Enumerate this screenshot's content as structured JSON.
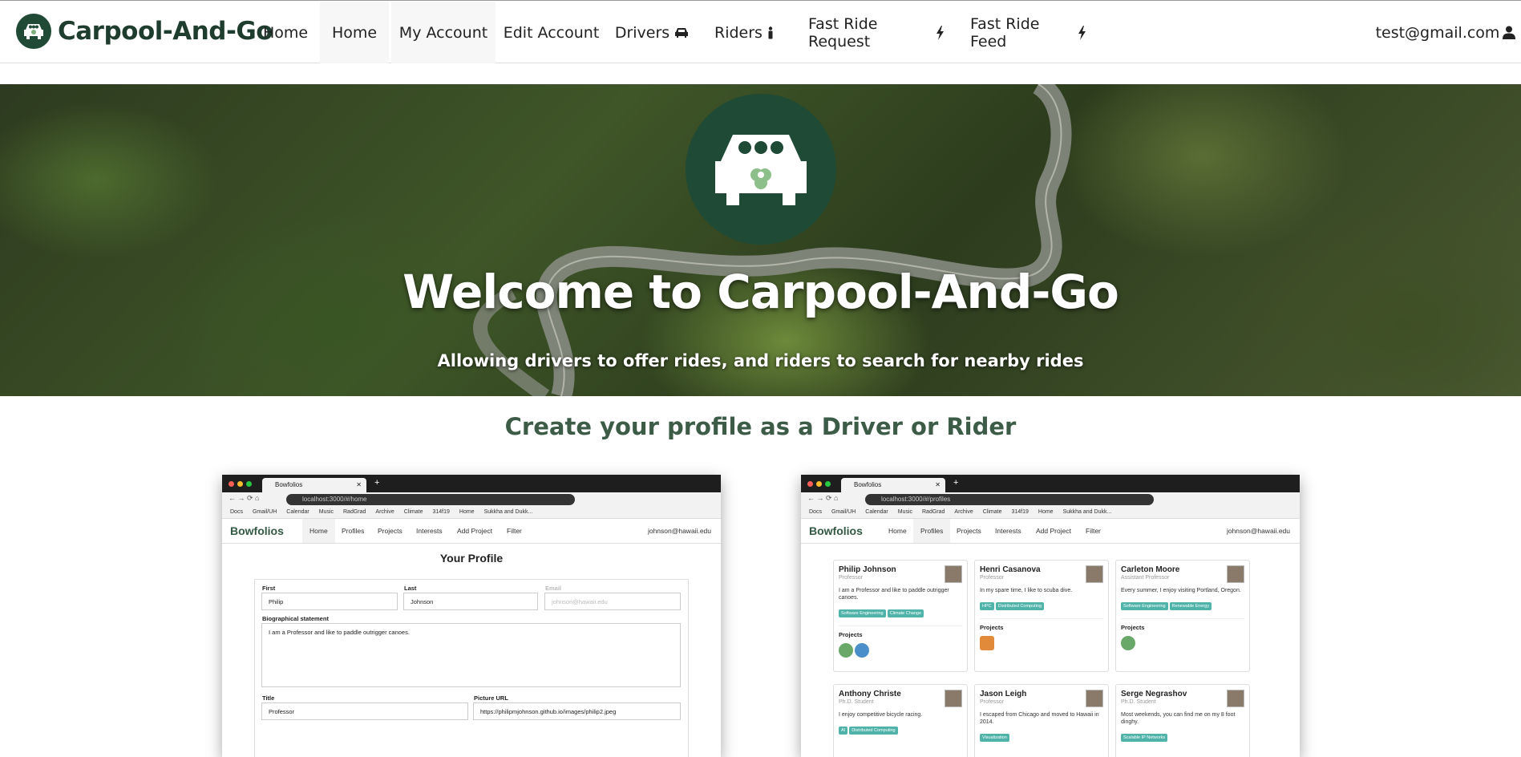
{
  "nav": {
    "brand": "Carpool-And-Go",
    "items": [
      "Home",
      "Home",
      "My Account",
      "Edit Account",
      "Drivers",
      "Riders",
      "Fast Ride Request",
      "Fast Ride Feed"
    ],
    "user": "test@gmail.com"
  },
  "hero": {
    "title": "Welcome to Carpool-And-Go",
    "subtitle": "Allowing drivers to offer rides, and riders to search for nearby rides"
  },
  "section": {
    "title": "Create your profile as a Driver or Rider"
  },
  "shot1": {
    "tab": "Bowfolios",
    "url": "localhost:3000/#/home",
    "bookmarks": [
      "Docs",
      "Gmail/UH",
      "Calendar",
      "Music",
      "RadGrad",
      "Archive",
      "Climate",
      "314f19",
      "Home",
      "Sukkha and Dukk..."
    ],
    "brand": "Bowfolios",
    "links": [
      "Home",
      "Profiles",
      "Projects",
      "Interests",
      "Add Project",
      "Filter"
    ],
    "user": "johnson@hawaii.edu",
    "form_title": "Your Profile",
    "first_label": "First",
    "first_value": "Philip",
    "last_label": "Last",
    "last_value": "Johnson",
    "email_label": "Email",
    "email_value": "johnson@hawaii.edu",
    "bio_label": "Biographical statement",
    "bio_value": "I am a Professor and like to paddle outrigger canoes.",
    "title_label": "Title",
    "title_value": "Professor",
    "picture_label": "Picture URL",
    "picture_value": "https://philipmjohnson.github.io/images/philip2.jpeg"
  },
  "shot2": {
    "tab": "Bowfolios",
    "url": "localhost:3000/#/profiles",
    "bookmarks": [
      "Docs",
      "Gmail/UH",
      "Calendar",
      "Music",
      "RadGrad",
      "Archive",
      "Climate",
      "314f19",
      "Home",
      "Sukkha and Dukk..."
    ],
    "brand": "Bowfolios",
    "links": [
      "Home",
      "Profiles",
      "Projects",
      "Interests",
      "Add Project",
      "Filter"
    ],
    "user": "johnson@hawaii.edu",
    "projects_label": "Projects",
    "cards": [
      {
        "name": "Philip Johnson",
        "role": "Professor",
        "bio": "I am a Professor and like to paddle outrigger canoes.",
        "tags": [
          "Software Engineering",
          "Climate Change"
        ]
      },
      {
        "name": "Henri Casanova",
        "role": "Professor",
        "bio": "In my spare time, I like to scuba dive.",
        "tags": [
          "HPC",
          "Distributed Computing"
        ]
      },
      {
        "name": "Carleton Moore",
        "role": "Assistant Professor",
        "bio": "Every summer, I enjoy visiting Portland, Oregon.",
        "tags": [
          "Software Engineering",
          "Renewable Energy"
        ]
      },
      {
        "name": "Anthony Christe",
        "role": "Ph.D. Student",
        "bio": "I enjoy competitive bicycle racing.",
        "tags": [
          "AI",
          "Distributed Computing"
        ]
      },
      {
        "name": "Jason Leigh",
        "role": "Professor",
        "bio": "I escaped from Chicago and moved to Hawaii in 2014.",
        "tags": [
          "Visualization"
        ]
      },
      {
        "name": "Serge Negrashov",
        "role": "Ph.D. Student",
        "bio": "Most weekends, you can find me on my 8 foot dinghy.",
        "tags": [
          "Scalable IP Networks"
        ]
      }
    ]
  },
  "colors": {
    "brand_green": "#1f4a35",
    "section_title": "#3d5c48",
    "tag_teal": "#4fb3a9"
  }
}
